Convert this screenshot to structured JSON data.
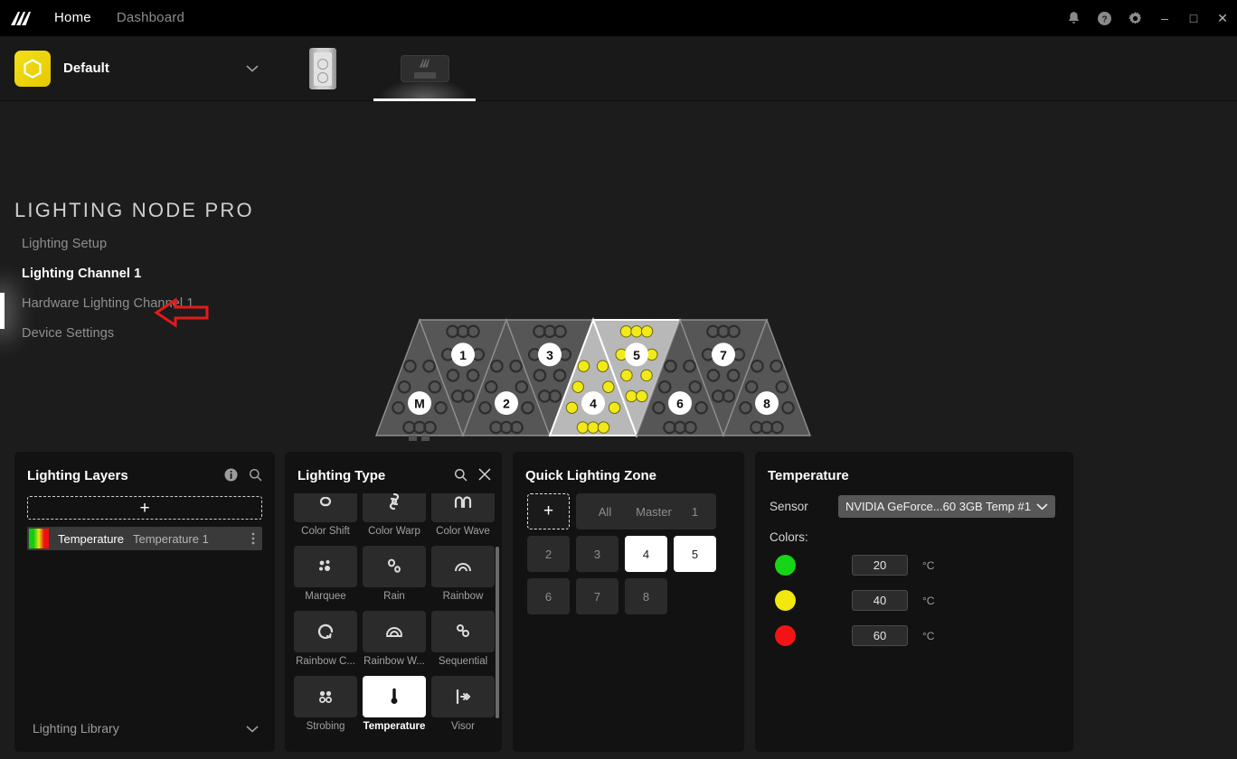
{
  "titlebar": {
    "nav": [
      {
        "label": "Home",
        "active": true
      },
      {
        "label": "Dashboard",
        "active": false
      }
    ],
    "icons": [
      "bell-icon",
      "help-icon",
      "gear-icon"
    ],
    "window_buttons": {
      "minimize": "–",
      "maximize": "□",
      "close": "✕"
    }
  },
  "profilebar": {
    "profile_name": "Default",
    "caret": "⌄",
    "device_tabs": [
      {
        "name": "pc-case",
        "active": false
      },
      {
        "name": "lighting-node-pro",
        "active": true
      }
    ]
  },
  "device": {
    "title": "LIGHTING NODE PRO",
    "nav": [
      {
        "label": "Lighting Setup",
        "selected": false
      },
      {
        "label": "Lighting Channel 1",
        "selected": true
      },
      {
        "label": "Hardware Lighting Channel 1",
        "selected": false
      },
      {
        "label": "Device Settings",
        "selected": false
      }
    ],
    "annotation": {
      "type": "red-arrow",
      "points_to": "Lighting Channel 1",
      "color": "#e01b1b"
    }
  },
  "preview": {
    "segments": [
      {
        "label": "M",
        "orientation": "up",
        "highlighted": false,
        "lit": false
      },
      {
        "label": "1",
        "orientation": "down",
        "highlighted": false,
        "lit": false
      },
      {
        "label": "2",
        "orientation": "up",
        "highlighted": false,
        "lit": false
      },
      {
        "label": "3",
        "orientation": "down",
        "highlighted": false,
        "lit": false
      },
      {
        "label": "4",
        "orientation": "up",
        "highlighted": true,
        "lit": true
      },
      {
        "label": "5",
        "orientation": "down",
        "highlighted": true,
        "lit": true
      },
      {
        "label": "6",
        "orientation": "up",
        "highlighted": false,
        "lit": false
      },
      {
        "label": "7",
        "orientation": "down",
        "highlighted": false,
        "lit": false
      },
      {
        "label": "8",
        "orientation": "up",
        "highlighted": false,
        "lit": false
      }
    ],
    "lit_color": "#f2e91a",
    "unlit_color": "#3d3d3d"
  },
  "layers_panel": {
    "title": "Lighting Layers",
    "info_icon": "info-icon",
    "search_icon": "search-icon",
    "add_label": "+",
    "layers": [
      {
        "name": "Temperature",
        "sub": "Temperature 1",
        "menu": "⋮"
      }
    ],
    "library_label": "Lighting Library",
    "library_caret": "⌄"
  },
  "type_panel": {
    "title": "Lighting Type",
    "search_icon": "search-icon",
    "close_icon": "close-icon",
    "items": [
      {
        "label": "Color Shift",
        "icon": "color-shift-icon",
        "selected": false
      },
      {
        "label": "Color Warp",
        "icon": "color-warp-icon",
        "selected": false
      },
      {
        "label": "Color Wave",
        "icon": "color-wave-icon",
        "selected": false
      },
      {
        "label": "Marquee",
        "icon": "marquee-icon",
        "selected": false
      },
      {
        "label": "Rain",
        "icon": "rain-icon",
        "selected": false
      },
      {
        "label": "Rainbow",
        "icon": "rainbow-icon",
        "selected": false
      },
      {
        "label": "Rainbow C...",
        "icon": "rainbow-circle-icon",
        "selected": false
      },
      {
        "label": "Rainbow W...",
        "icon": "rainbow-wave-icon",
        "selected": false
      },
      {
        "label": "Sequential",
        "icon": "sequential-icon",
        "selected": false
      },
      {
        "label": "Strobing",
        "icon": "strobing-icon",
        "selected": false
      },
      {
        "label": "Temperature",
        "icon": "thermometer-icon",
        "selected": true
      },
      {
        "label": "Visor",
        "icon": "visor-icon",
        "selected": false
      }
    ]
  },
  "zone_panel": {
    "title": "Quick Lighting Zone",
    "add_label": "+",
    "zones": [
      {
        "label": "All",
        "selected": false,
        "wide": true
      },
      {
        "label": "Master",
        "selected": false,
        "wide": true
      },
      {
        "label": "1",
        "selected": false,
        "wide": false
      },
      {
        "label": "2",
        "selected": false,
        "wide": false
      },
      {
        "label": "3",
        "selected": false,
        "wide": false
      },
      {
        "label": "4",
        "selected": true,
        "wide": false
      },
      {
        "label": "5",
        "selected": true,
        "wide": false
      },
      {
        "label": "6",
        "selected": false,
        "wide": false
      },
      {
        "label": "7",
        "selected": false,
        "wide": false
      },
      {
        "label": "8",
        "selected": false,
        "wide": false
      }
    ]
  },
  "temperature_panel": {
    "title": "Temperature",
    "sensor_label": "Sensor",
    "sensor_value": "NVIDIA GeForce...60 3GB Temp #1",
    "sensor_caret": "⌄",
    "colors_label": "Colors:",
    "stops": [
      {
        "color": "#16d416",
        "value": "20",
        "unit": "°C"
      },
      {
        "color": "#f2e80e",
        "value": "40",
        "unit": "°C"
      },
      {
        "color": "#f21414",
        "value": "60",
        "unit": "°C"
      }
    ]
  }
}
